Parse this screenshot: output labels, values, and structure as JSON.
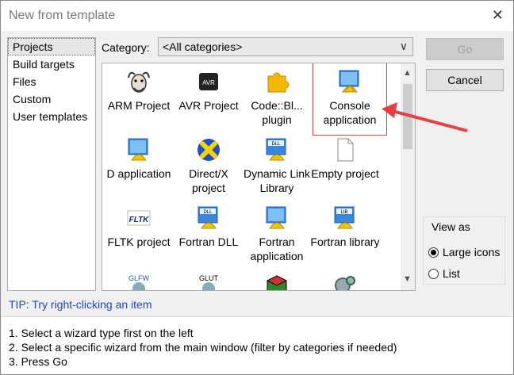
{
  "window": {
    "title": "New from template",
    "close_glyph": "✕"
  },
  "left_list": {
    "items": [
      {
        "label": "Projects",
        "selected": true
      },
      {
        "label": "Build targets"
      },
      {
        "label": "Files"
      },
      {
        "label": "Custom"
      },
      {
        "label": "User templates"
      }
    ]
  },
  "category": {
    "label": "Category:",
    "value": "<All categories>",
    "chevron": "∨"
  },
  "templates": [
    {
      "label": "ARM Project",
      "icon": "gnu-icon"
    },
    {
      "label": "AVR Project",
      "icon": "avr-chip-icon"
    },
    {
      "label": "Code::Bl... plugin",
      "icon": "puzzle-icon"
    },
    {
      "label": "Console application",
      "icon": "console-app-icon",
      "highlighted": true
    },
    {
      "label": "D application",
      "icon": "d-app-icon"
    },
    {
      "label": "Direct/X project",
      "icon": "directx-icon"
    },
    {
      "label": "Dynamic Link Library",
      "icon": "dll-icon"
    },
    {
      "label": "Empty project",
      "icon": "blank-file-icon"
    },
    {
      "label": "FLTK project",
      "icon": "fltk-icon"
    },
    {
      "label": "Fortran DLL",
      "icon": "dll-icon"
    },
    {
      "label": "Fortran application",
      "icon": "console-app-icon"
    },
    {
      "label": "Fortran library",
      "icon": "lib-icon"
    },
    {
      "label": "",
      "icon": "glfw-icon"
    },
    {
      "label": "",
      "icon": "glut-icon"
    },
    {
      "label": "",
      "icon": "gtk-icon"
    },
    {
      "label": "",
      "icon": "gears-icon"
    }
  ],
  "icon_texts": {
    "avr": "AVR",
    "dll": "DLL",
    "lib": "LIB",
    "fltk": "FLTK",
    "glfw": "GLFW",
    "glut": "GLUT"
  },
  "buttons": {
    "go": "Go",
    "go_disabled": true,
    "cancel": "Cancel"
  },
  "view_as": {
    "legend": "View as",
    "options": [
      {
        "label": "Large icons",
        "checked": true
      },
      {
        "label": "List",
        "checked": false
      }
    ]
  },
  "tip": "TIP: Try right-clicking an item",
  "instructions": [
    "1. Select a wizard type first on the left",
    "2. Select a specific wizard from the main window (filter by categories if needed)",
    "3. Press Go"
  ],
  "colors": {
    "tip_text": "#1a48c8",
    "highlight_box": "#e04040",
    "annotation_arrow": "#e84040"
  }
}
